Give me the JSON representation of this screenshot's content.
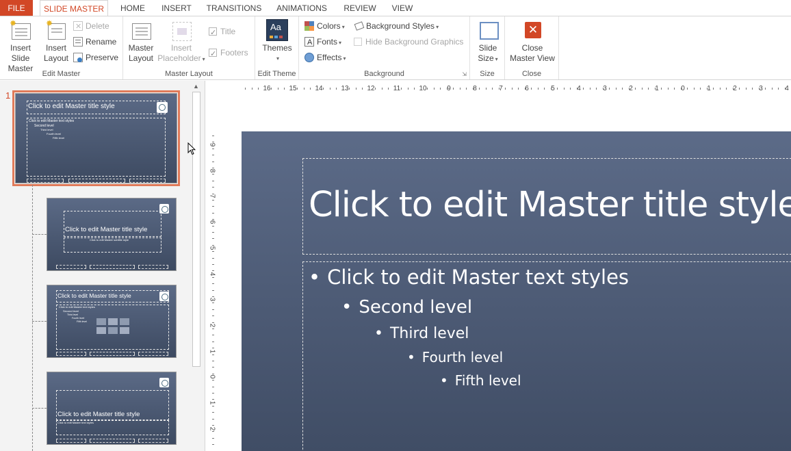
{
  "tabs": {
    "file": "FILE",
    "items": [
      "SLIDE MASTER",
      "HOME",
      "INSERT",
      "TRANSITIONS",
      "ANIMATIONS",
      "REVIEW",
      "VIEW"
    ]
  },
  "ribbon": {
    "edit_master": {
      "label": "Edit Master",
      "insert_slide_master": [
        "Insert Slide",
        "Master"
      ],
      "insert_layout": [
        "Insert",
        "Layout"
      ],
      "delete": "Delete",
      "rename": "Rename",
      "preserve": "Preserve"
    },
    "master_layout": {
      "label": "Master Layout",
      "master_layout": [
        "Master",
        "Layout"
      ],
      "insert_placeholder": [
        "Insert",
        "Placeholder"
      ],
      "title": "Title",
      "footers": "Footers"
    },
    "edit_theme": {
      "label": "Edit Theme",
      "themes": "Themes"
    },
    "background": {
      "label": "Background",
      "colors": "Colors",
      "fonts": "Fonts",
      "effects": "Effects",
      "background_styles": "Background Styles",
      "hide_bg_graphics": "Hide Background Graphics"
    },
    "size": {
      "label": "Size",
      "slide_size": [
        "Slide",
        "Size"
      ]
    },
    "close": {
      "label": "Close",
      "close_master_view": [
        "Close",
        "Master View"
      ]
    }
  },
  "slide_pane": {
    "slide_number": "1",
    "thumbs": [
      {
        "title": "Click to edit Master title style",
        "body": [
          "Click to edit Master text styles",
          "Second level",
          "Third level",
          "Fourth level",
          "Fifth level"
        ]
      },
      {
        "title": "Click to edit Master title style",
        "sub": "Click to edit Master subtitle style"
      },
      {
        "title": "Click to edit Master title style",
        "body": [
          "Click to edit Master text styles",
          "Second level",
          "Third level",
          "Fourth level",
          "Fifth level"
        ]
      },
      {
        "title": "Click to edit Master title style",
        "sub": "Click to edit Master text styles"
      }
    ]
  },
  "ruler": {
    "h": [
      "16",
      "15",
      "14",
      "13",
      "12",
      "11",
      "10",
      "9",
      "8",
      "7",
      "6",
      "5",
      "4",
      "3",
      "2",
      "1",
      "0",
      "1",
      "2",
      "3",
      "4"
    ],
    "v": [
      "9",
      "8",
      "7",
      "6",
      "5",
      "4",
      "3",
      "2",
      "1",
      "0",
      "1",
      "2"
    ]
  },
  "slide": {
    "title": "Click to edit Master title style",
    "levels": [
      "Click to edit Master text styles",
      "Second level",
      "Third level",
      "Fourth level",
      "Fifth level"
    ]
  },
  "colors": {
    "accent": "#d24726",
    "slide_top": "#5c6b88",
    "slide_bottom": "#404d65"
  }
}
